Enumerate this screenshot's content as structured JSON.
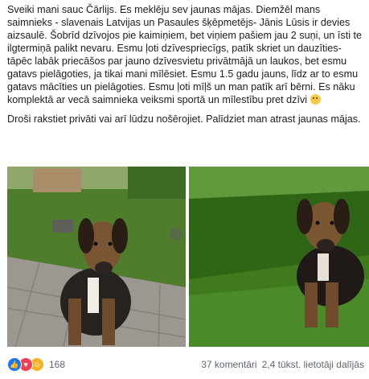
{
  "post": {
    "paragraphs": [
      "Sveiki mani sauc Čārlijs. Es meklēju sev jaunas mājas. Diemžēl mans saimnieks - slavenais Latvijas un Pasaules šķēpmetējs- Jānis Lūsis ir devies aizsaulē. Šobrīd dzīvojos pie kaimiņiem, bet viņiem pašiem jau 2 suņi, un īsti te ilgtermiņā palikt nevaru. Esmu ļoti dzīvespriecīgs, patīk skriet un dauzīties- tāpēc labāk priecāšos par jauno dzīvesvietu privātmājā un laukos, bet esmu gatavs pielāgoties, ja tikai mani mīlēsiet. Esmu 1.5 gadu jauns, līdz ar to esmu gatavs mācīties un pielāgoties. Esmu ļoti mīļš un man patīk arī bērni. Es nāku komplektā ar vecā saimnieka veiksmi sportā un mīlestību pret dzīvi",
      "Droši rakstiet privāti vai arī lūdzu nošērojiet. Palīdziet man atrast jaunas mājas."
    ]
  },
  "icons": {
    "emoji": "smiley-emoji-icon",
    "like": "like-reaction-icon",
    "love": "love-reaction-icon",
    "haha": "haha-reaction-icon"
  },
  "reactions": {
    "count": "168"
  },
  "stats": {
    "comments": "37 komentāri",
    "shares": "2,4 tūkst. lietotāji dalījās"
  },
  "colors": {
    "like": "#1877f2",
    "love": "#f33e58",
    "haha": "#f7b125",
    "meta_text": "#606770"
  }
}
